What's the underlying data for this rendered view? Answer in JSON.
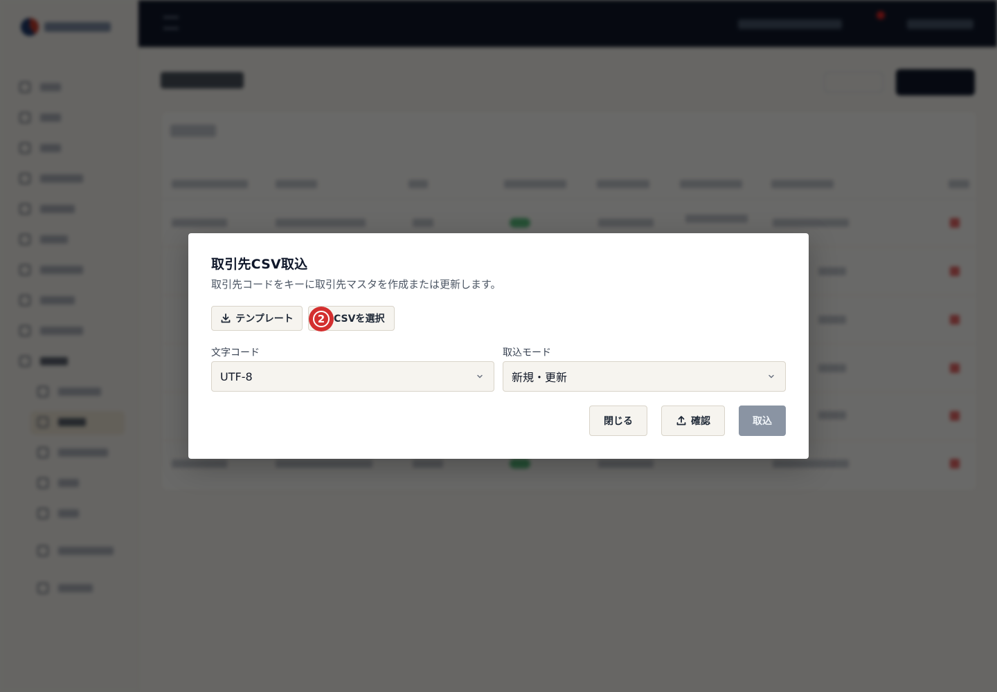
{
  "modal": {
    "title": "取引先CSV取込",
    "description": "取引先コードをキーに取引先マスタを作成または更新します。",
    "template_button": "テンプレート",
    "select_csv_button": "CSVを選択",
    "step_badge": "2",
    "encoding": {
      "label": "文字コード",
      "value": "UTF-8"
    },
    "import_mode": {
      "label": "取込モード",
      "value": "新規・更新"
    },
    "close_button": "閉じる",
    "confirm_button": "確認",
    "import_button": "取込"
  },
  "colors": {
    "badge": "#d32f2f",
    "topbar": "#0f172a",
    "import_button_disabled": "#8a94a3"
  },
  "icons": {
    "template": "download-icon",
    "confirm": "upload-icon",
    "select": "chevron-down-icon"
  }
}
